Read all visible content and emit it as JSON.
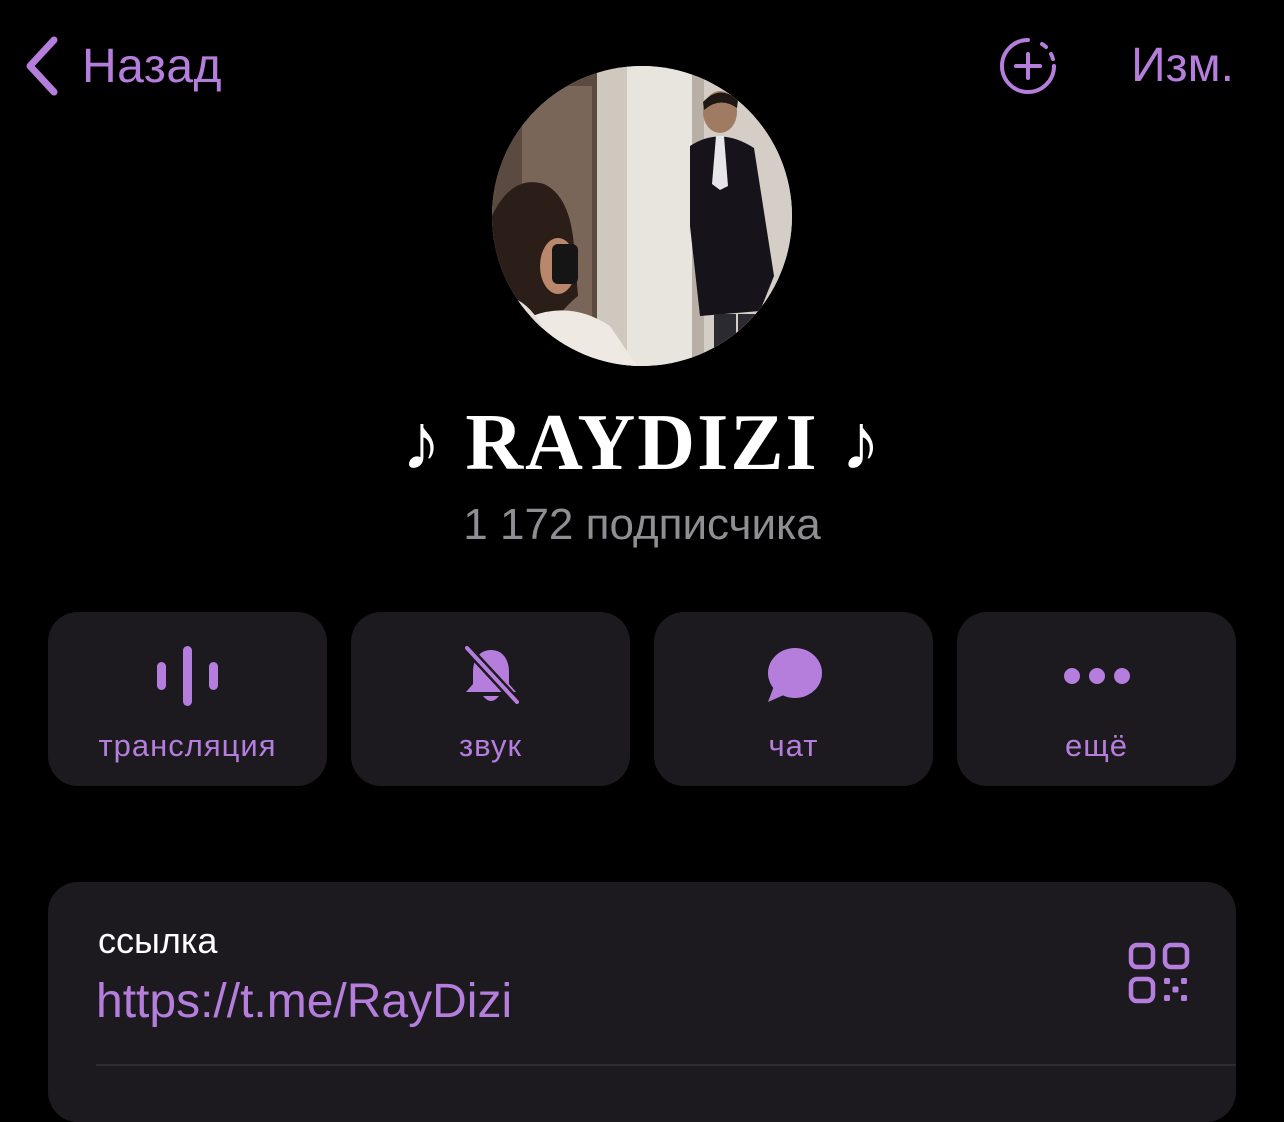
{
  "nav": {
    "back_label": "Назад",
    "edit_label": "Изм."
  },
  "channel": {
    "title": "♪ RAYDIZI ♪",
    "subscribers": "1 172 подписчика"
  },
  "actions": [
    {
      "label": "трансляция",
      "icon": "voice-chat-icon"
    },
    {
      "label": "звук",
      "icon": "bell-muted-icon"
    },
    {
      "label": "чат",
      "icon": "chat-bubble-icon"
    },
    {
      "label": "ещё",
      "icon": "more-dots-icon"
    }
  ],
  "info": {
    "link_caption": "ссылка",
    "link_value": "https://t.me/RayDizi"
  },
  "colors": {
    "accent": "#b57edc",
    "background": "#000000",
    "card": "#1c1a1f",
    "secondary_text": "#8e8e93"
  }
}
